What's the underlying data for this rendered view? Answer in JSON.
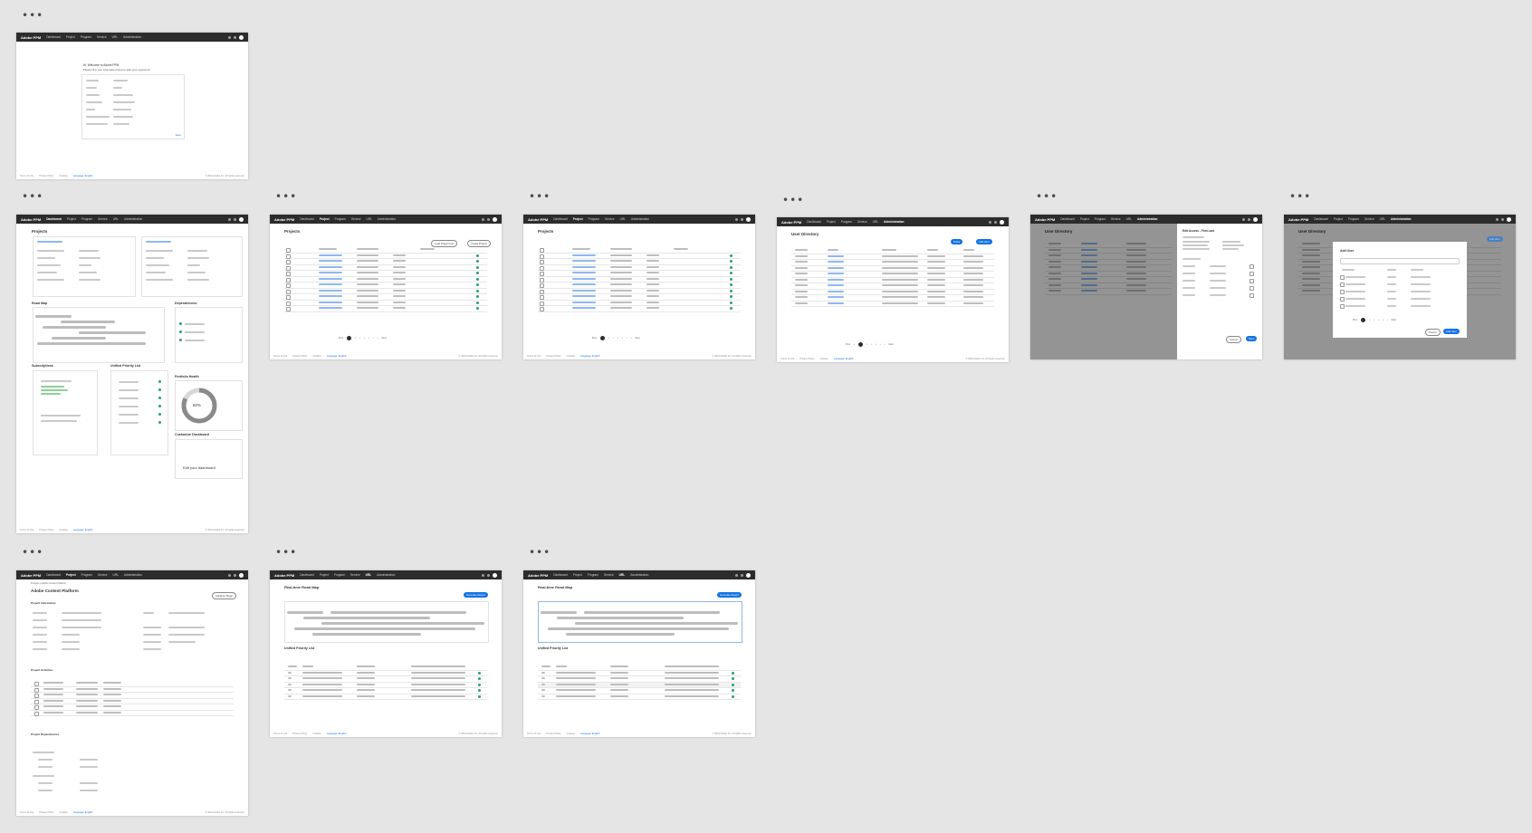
{
  "app": {
    "logo": "Adobe PPM"
  },
  "nav_items": [
    "Dashboard",
    "Project",
    "Program",
    "Service",
    "URL",
    "Administration"
  ],
  "frames": {
    "welcome": {
      "title": "Hi, Welcome to Adobe PPM",
      "subtitle": "Please fill in your information below to start your experience.",
      "submit": "Save"
    },
    "dashboard": {
      "projects": "Projects",
      "road_map": "Road Map",
      "dependencies": "Dependencies",
      "subscriptions": "Subscriptions",
      "upl": "Unified Priority List",
      "health": "Portfolio Health",
      "health_value": "82%",
      "customize": "Customize Dashboard",
      "edit": "Edit your dashboard"
    },
    "projects_a": {
      "title": "Projects",
      "btn_load": "Load Project List",
      "btn_create": "Create Project"
    },
    "projects_b": {
      "title": "Projects"
    },
    "user_dir": {
      "title": "User Directory",
      "btn_a": "Roles",
      "btn_b": "Add User"
    },
    "user_edit": {
      "title": "User Directory",
      "panel_title": "Edit Access - First Last",
      "cancel": "Cancel",
      "save": "Save"
    },
    "user_add": {
      "title": "User Directory",
      "dialog_title": "Add User",
      "cancel": "Cancel",
      "confirm": "Add User"
    },
    "project_detail": {
      "breadcrumb": "Projects / Adobe Content Platform",
      "title": "Adobe Content Platform",
      "stage_btn": "Advance Stage",
      "info": "Project Information",
      "activities": "Project Activities",
      "deps": "Project Dependencies"
    },
    "roadmap_a": {
      "title": "Real-time Road Map",
      "btn": "Generate Report",
      "upl": "Unified Priority List"
    },
    "roadmap_b": {
      "title": "Real-time Road Map",
      "btn": "Generate Report",
      "upl": "Unified Priority List"
    }
  },
  "footer": {
    "links": [
      "Terms of Use",
      "Privacy Policy",
      "Cookies"
    ],
    "language": "Language: English",
    "copyright": "© 2019 Adobe Inc. All rights reserved."
  },
  "pagination": {
    "prev": "Prev",
    "next": "Next"
  }
}
